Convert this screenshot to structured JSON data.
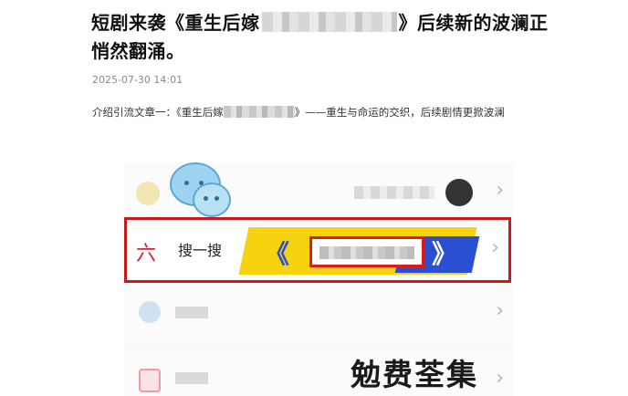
{
  "article": {
    "title_part1": "短剧来袭《重生后嫁",
    "title_part2": "》后续新的波澜正悄然翻涌。",
    "date": "2025-07-30 14:01",
    "intro_part1": "介绍引流文章一：《重生后嫁",
    "intro_part2": "》——重生与命运的交织，后续剧情更掀波澜"
  },
  "phone_menu": {
    "search_label": "搜一搜",
    "search_icon_glyph": "六",
    "chevron": "›",
    "banner_left": "《",
    "banner_right": "》"
  },
  "overlay": {
    "watermark": "勉费荃集"
  },
  "colors": {
    "highlight_border": "#c51b1b",
    "banner_yellow": "#f7d20e",
    "banner_blue": "#2b4fd1"
  }
}
